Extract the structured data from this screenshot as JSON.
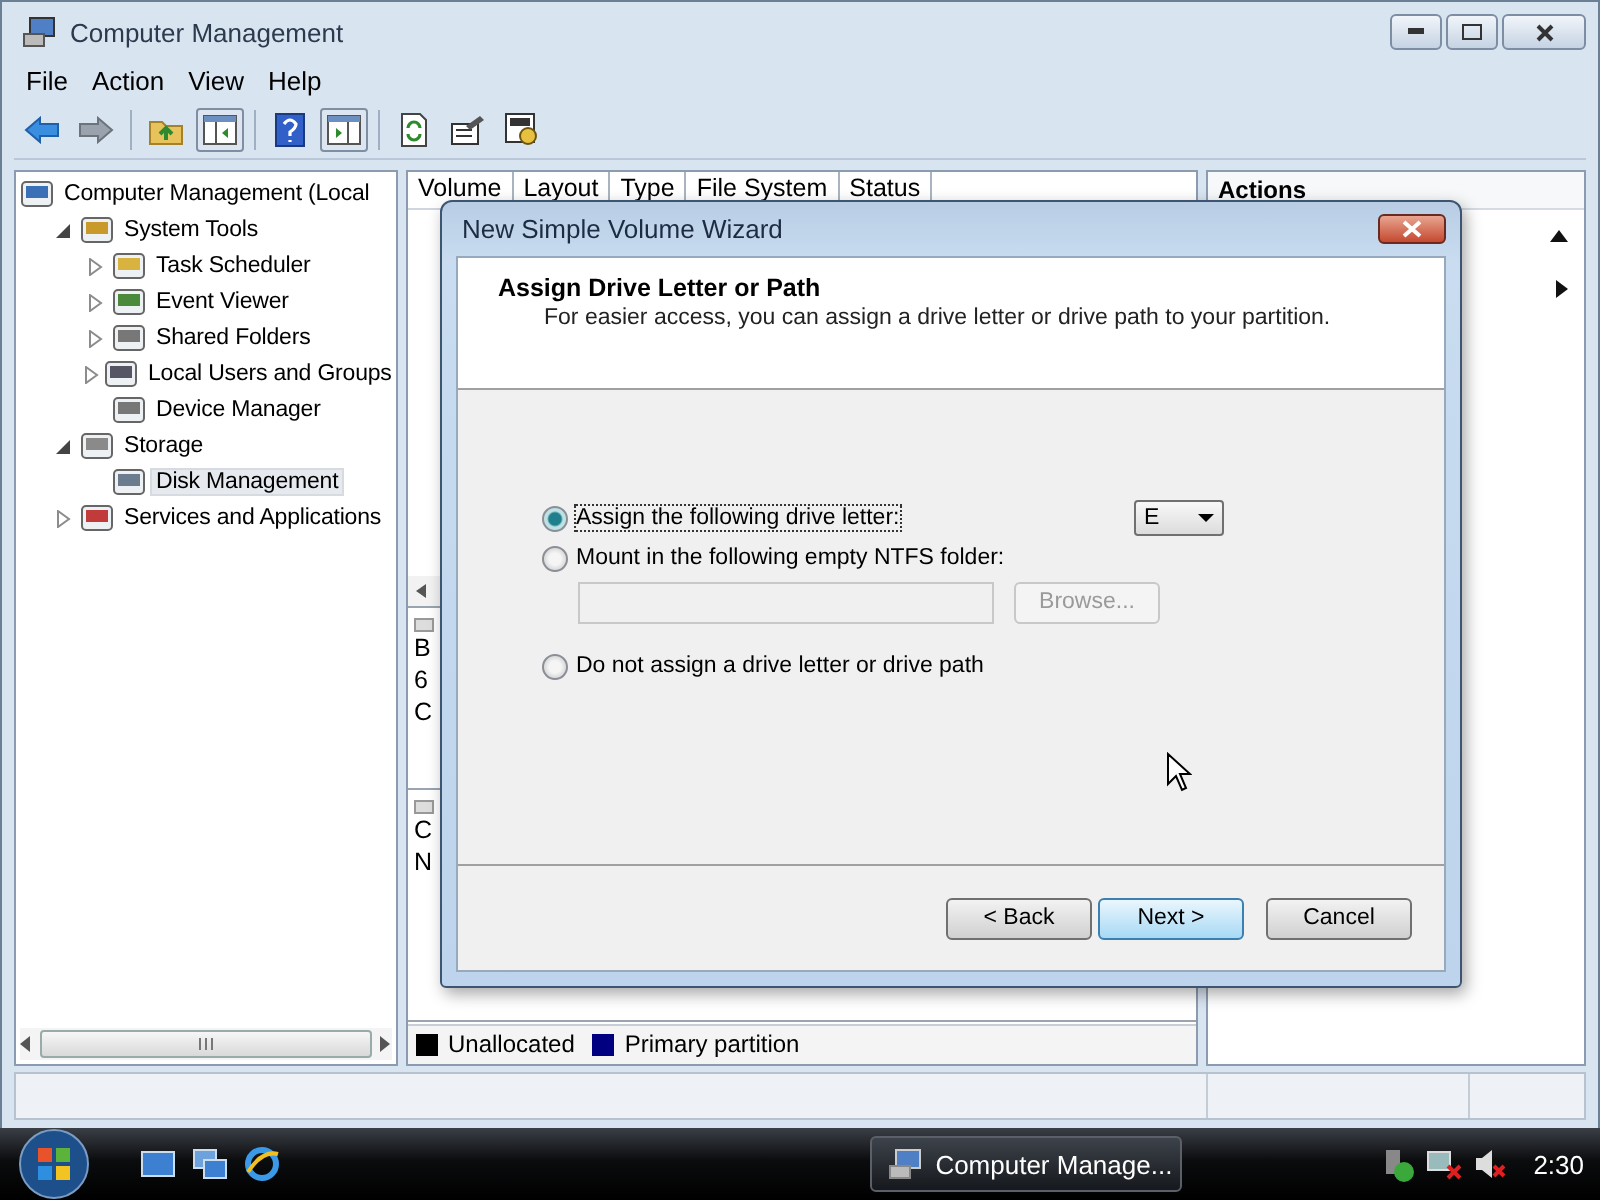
{
  "window": {
    "title": "Computer Management"
  },
  "menu": [
    {
      "label": "File"
    },
    {
      "label": "Action"
    },
    {
      "label": "View"
    },
    {
      "label": "Help"
    }
  ],
  "toolbar": [
    {
      "kind": "button",
      "pressed": false
    },
    {
      "kind": "button",
      "pressed": false
    },
    {
      "kind": "separator"
    },
    {
      "kind": "button",
      "pressed": false
    },
    {
      "kind": "button",
      "pressed": true
    },
    {
      "kind": "separator"
    },
    {
      "kind": "button",
      "pressed": false
    },
    {
      "kind": "button",
      "pressed": true
    },
    {
      "kind": "separator"
    },
    {
      "kind": "button",
      "pressed": false
    },
    {
      "kind": "button",
      "pressed": false
    },
    {
      "kind": "button",
      "pressed": false
    }
  ],
  "tree": [
    {
      "label": "Computer Management (Local",
      "selected": false,
      "children": [
        {
          "label": "System Tools",
          "selected": false,
          "expanded": true,
          "children": [
            {
              "label": "Task Scheduler",
              "selected": false,
              "expanded": false
            },
            {
              "label": "Event Viewer",
              "selected": false,
              "expanded": false
            },
            {
              "label": "Shared Folders",
              "selected": false,
              "expanded": false
            },
            {
              "label": "Local Users and Groups",
              "selected": false,
              "expanded": false
            },
            {
              "label": "Device Manager",
              "selected": false
            }
          ]
        },
        {
          "label": "Storage",
          "selected": false,
          "expanded": true,
          "children": [
            {
              "label": "Disk Management",
              "selected": true
            }
          ]
        },
        {
          "label": "Services and Applications",
          "selected": false,
          "expanded": false
        }
      ]
    }
  ],
  "columns": [
    "Volume",
    "Layout",
    "Type",
    "File System",
    "Status"
  ],
  "disk_rows": [
    {
      "lines": [
        "B",
        "6",
        "C"
      ]
    },
    {
      "lines": [
        "C",
        "N"
      ]
    }
  ],
  "legend": [
    {
      "label": "Unallocated",
      "color": "#000000"
    },
    {
      "label": "Primary partition",
      "color": "#000080"
    }
  ],
  "actions": {
    "title": "Actions"
  },
  "dialog": {
    "title": "New Simple Volume Wizard",
    "heading": "Assign Drive Letter or Path",
    "subheading": "For easier access, you can assign a drive letter or drive path to your partition.",
    "options": [
      {
        "kind": "drive_letter",
        "label": "Assign the following drive letter:",
        "selected": true,
        "value": "E"
      },
      {
        "kind": "folder",
        "label": "Mount in the following empty NTFS folder:",
        "selected": false,
        "disabled": true,
        "button": {
          "label": "Browse..."
        }
      },
      {
        "kind": "none",
        "label": "Do not assign a drive letter or drive path",
        "selected": false
      }
    ],
    "buttons": [
      {
        "label": "< Back",
        "default": false
      },
      {
        "label": "Next >",
        "default": true
      },
      {
        "label": "Cancel",
        "default": false
      }
    ]
  },
  "taskbar": {
    "task": "Computer Manage...",
    "clock": "2:30"
  }
}
